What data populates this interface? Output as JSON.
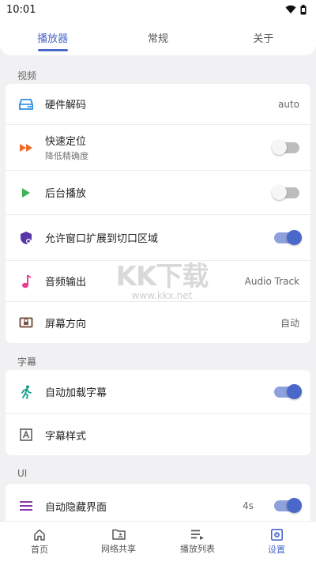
{
  "status_bar": {
    "time": "10:01",
    "wifi_icon": "wifi-icon",
    "battery_icon": "battery-icon"
  },
  "top_tabs": [
    {
      "label": "播放器",
      "active": true
    },
    {
      "label": "常规",
      "active": false
    },
    {
      "label": "关于",
      "active": false
    }
  ],
  "sections": {
    "video": {
      "label": "视频",
      "rows": [
        {
          "icon": "hard-drive-icon",
          "title": "硬件解码",
          "value": "auto"
        },
        {
          "icon": "fast-forward-icon",
          "title": "快速定位",
          "subtitle": "降低精确度",
          "toggle": "off"
        },
        {
          "icon": "play-icon",
          "title": "后台播放",
          "toggle": "off"
        },
        {
          "icon": "shield-icon",
          "title": "允许窗口扩展到切口区域",
          "toggle": "on"
        },
        {
          "icon": "music-note-icon",
          "title": "音频输出",
          "value": "Audio Track"
        },
        {
          "icon": "screen-rotation-icon",
          "title": "屏幕方向",
          "value": "自动"
        }
      ]
    },
    "subtitle": {
      "label": "字幕",
      "rows": [
        {
          "icon": "running-icon",
          "title": "自动加载字幕",
          "toggle": "on"
        },
        {
          "icon": "font-box-icon",
          "title": "字幕样式"
        }
      ]
    },
    "ui": {
      "label": "UI",
      "rows": [
        {
          "icon": "menu-icon",
          "title": "自动隐藏界面",
          "value": "4s",
          "toggle": "on"
        }
      ]
    }
  },
  "watermark": {
    "big": "KK下载",
    "small": "www.kkx.net"
  },
  "bottom_nav": [
    {
      "icon": "home-icon",
      "label": "首页",
      "active": false
    },
    {
      "icon": "folder-share-icon",
      "label": "网络共享",
      "active": false
    },
    {
      "icon": "playlist-icon",
      "label": "播放列表",
      "active": false
    },
    {
      "icon": "settings-icon",
      "label": "设置",
      "active": true
    }
  ],
  "colors": {
    "accent": "#4a68c9",
    "toggle_track_on": "#8ea1dc",
    "background": "#f1f1f3"
  }
}
